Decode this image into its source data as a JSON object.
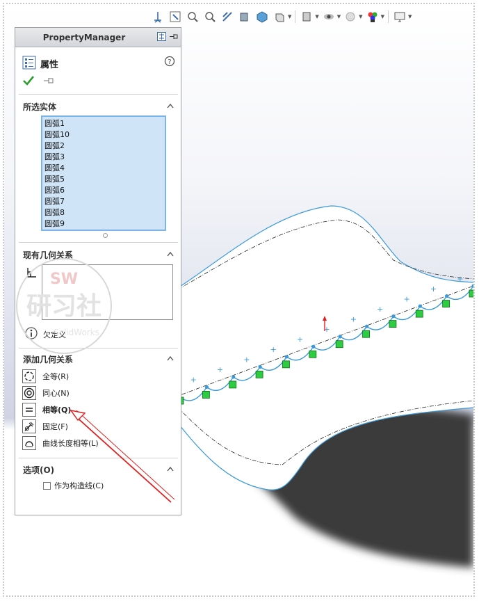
{
  "panel": {
    "title": "PropertyManager",
    "property_title": "属性"
  },
  "sections": {
    "selected_entities": {
      "label": "所选实体",
      "items": [
        "圆弧1",
        "圆弧10",
        "圆弧2",
        "圆弧3",
        "圆弧4",
        "圆弧5",
        "圆弧6",
        "圆弧7",
        "圆弧8",
        "圆弧9"
      ]
    },
    "existing_relations": {
      "label": "现有几何关系",
      "status": "欠定义"
    },
    "add_relations": {
      "label": "添加几何关系",
      "items": [
        {
          "label": "全等(R)",
          "icon": "coradial-icon"
        },
        {
          "label": "同心(N)",
          "icon": "concentric-icon"
        },
        {
          "label": "相等(Q)",
          "icon": "equal-icon"
        },
        {
          "label": "固定(F)",
          "icon": "fix-icon"
        },
        {
          "label": "曲线长度相等(L)",
          "icon": "equal-curve-length-icon"
        }
      ]
    },
    "options": {
      "label": "选项(O)",
      "construction_label": "作为构造线(C)",
      "construction_checked": false
    }
  },
  "watermark": {
    "top": "SW",
    "main": "研习社",
    "sub": "SolidWorks"
  },
  "colors": {
    "accept": "#2c9c2c",
    "selection_bg": "#cfe4f7",
    "selection_border": "#7db4e8",
    "sketch_curve": "#3a9ad9",
    "relation_marker": "#2ecc40",
    "annotation_arrow": "#e02020",
    "shadow": "#3a3a3a"
  }
}
